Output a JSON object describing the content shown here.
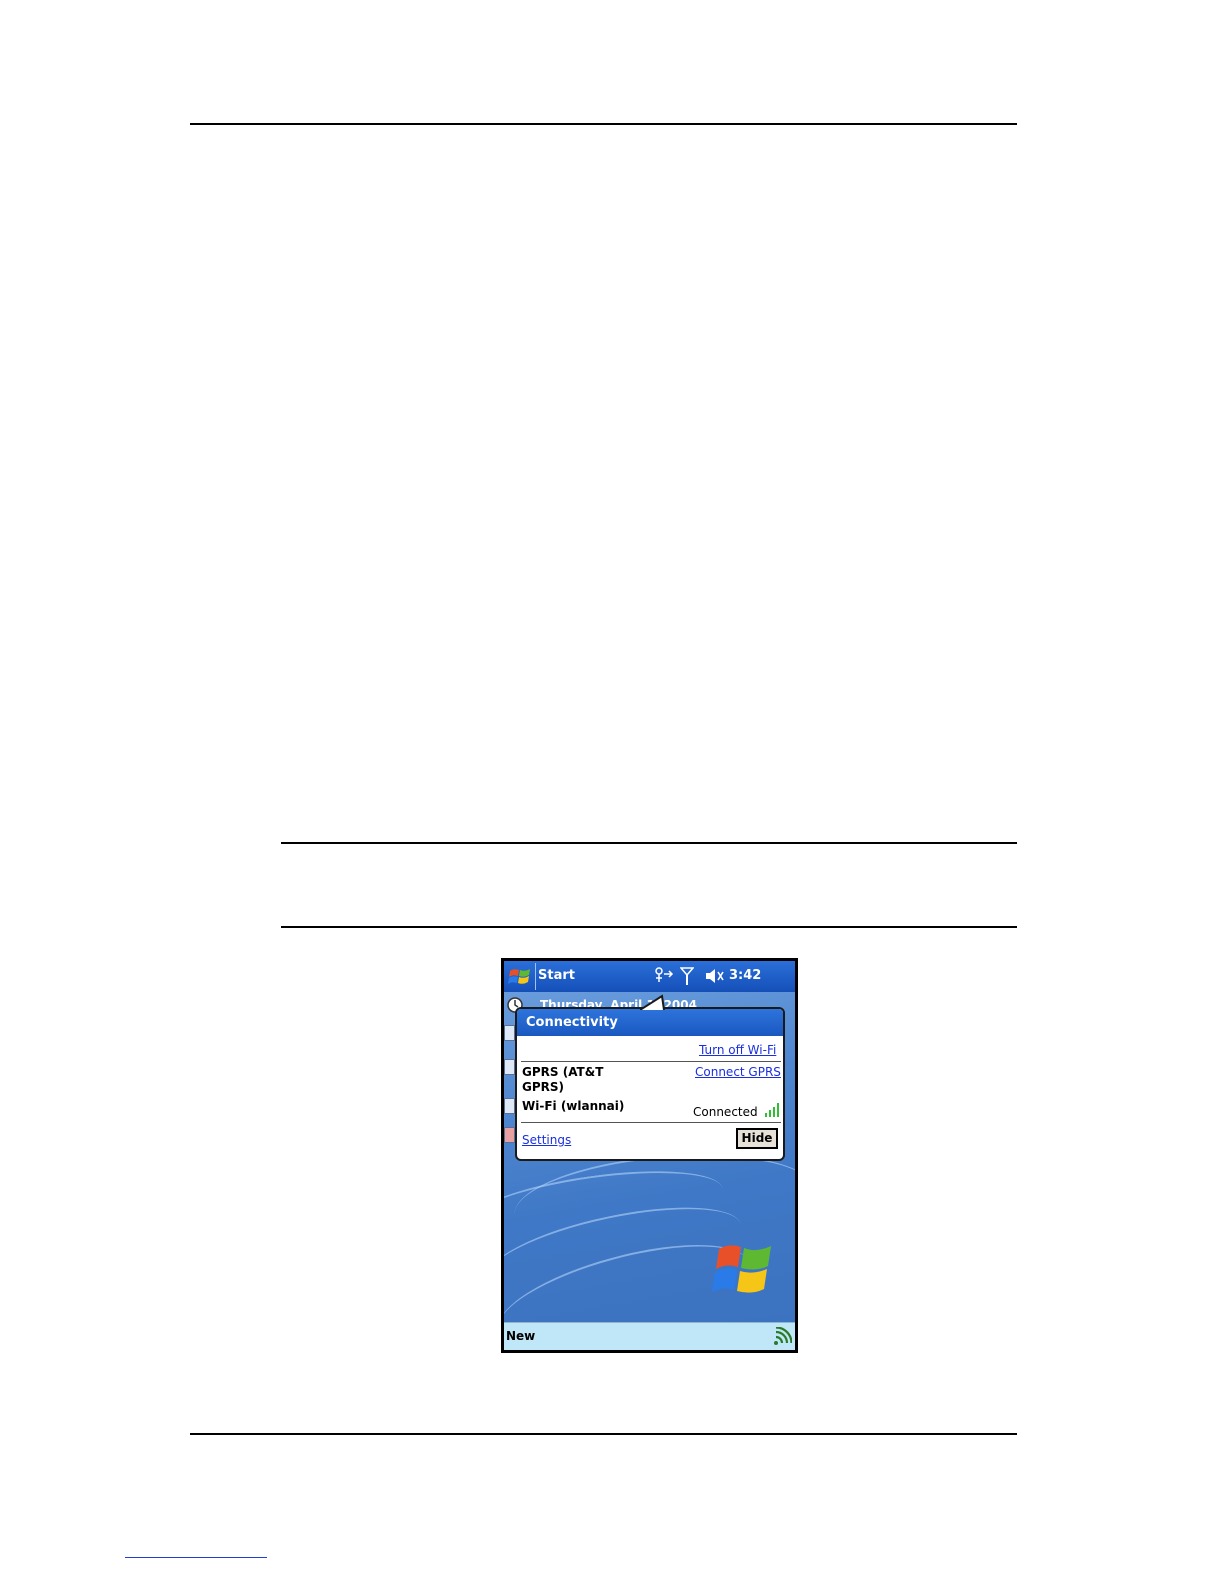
{
  "device": {
    "taskbar": {
      "start_label": "Start",
      "clock": "3:42",
      "icons": [
        "connectivity-icon",
        "antenna-icon",
        "speaker-muted-icon"
      ]
    },
    "today": {
      "date": "Thursday, April 1, 2004"
    },
    "popup": {
      "title": "Connectivity",
      "turn_off_link": "Turn off Wi-Fi",
      "gprs_label_line1": "GPRS (AT&T",
      "gprs_label_line2": "GPRS)",
      "connect_link": "Connect GPRS",
      "wifi_label": "Wi-Fi (wlannai)",
      "wifi_status": "Connected",
      "settings_link": "Settings",
      "hide_button": "Hide"
    },
    "menubar": {
      "left_label": "New"
    },
    "colors": {
      "taskbar": "#1a5cc6",
      "link": "#1a2fe0",
      "menubar": "#bfe7f7"
    }
  }
}
